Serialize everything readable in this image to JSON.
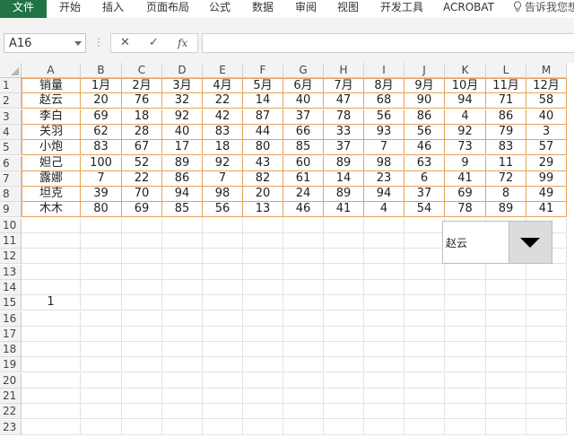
{
  "ribbon": {
    "tabs": [
      "文件",
      "开始",
      "插入",
      "页面布局",
      "公式",
      "数据",
      "审阅",
      "视图",
      "开发工具",
      "ACROBAT"
    ],
    "tell_me": "告诉我您想"
  },
  "formula_bar": {
    "name_box": "A16",
    "cancel_symbol": "✕",
    "enter_symbol": "✓",
    "fx_symbol": "fx",
    "formula": ""
  },
  "sheet": {
    "columns": [
      "A",
      "B",
      "C",
      "D",
      "E",
      "F",
      "G",
      "H",
      "I",
      "J",
      "K",
      "L",
      "M"
    ],
    "rows": [
      "1",
      "2",
      "3",
      "4",
      "5",
      "6",
      "7",
      "8",
      "9",
      "10",
      "11",
      "12",
      "13",
      "14",
      "15",
      "16",
      "17",
      "18",
      "19",
      "20",
      "21",
      "22",
      "23"
    ],
    "header": [
      "销量",
      "1月",
      "2月",
      "3月",
      "4月",
      "5月",
      "6月",
      "7月",
      "8月",
      "9月",
      "10月",
      "11月",
      "12月"
    ],
    "table": [
      [
        "赵云",
        "20",
        "76",
        "32",
        "22",
        "14",
        "40",
        "47",
        "68",
        "90",
        "94",
        "71",
        "58"
      ],
      [
        "李白",
        "69",
        "18",
        "92",
        "42",
        "87",
        "37",
        "78",
        "56",
        "86",
        "4",
        "86",
        "40"
      ],
      [
        "关羽",
        "62",
        "28",
        "40",
        "83",
        "44",
        "66",
        "33",
        "93",
        "56",
        "92",
        "79",
        "3"
      ],
      [
        "小炮",
        "83",
        "67",
        "17",
        "18",
        "80",
        "85",
        "37",
        "7",
        "46",
        "73",
        "83",
        "57"
      ],
      [
        "妲己",
        "100",
        "52",
        "89",
        "92",
        "43",
        "60",
        "89",
        "98",
        "63",
        "9",
        "11",
        "29"
      ],
      [
        "露娜",
        "7",
        "22",
        "86",
        "7",
        "82",
        "61",
        "14",
        "23",
        "6",
        "41",
        "72",
        "99"
      ],
      [
        "坦克",
        "39",
        "70",
        "94",
        "98",
        "20",
        "24",
        "89",
        "94",
        "37",
        "69",
        "8",
        "49"
      ],
      [
        "木木",
        "80",
        "69",
        "85",
        "56",
        "13",
        "46",
        "41",
        "4",
        "54",
        "78",
        "89",
        "41"
      ]
    ],
    "a15_value": "1"
  },
  "combo_box": {
    "selected": "赵云"
  },
  "colors": {
    "file_tab": "#217346",
    "table_border": "#e6a35a",
    "header_bg": "#f3f3f3"
  }
}
